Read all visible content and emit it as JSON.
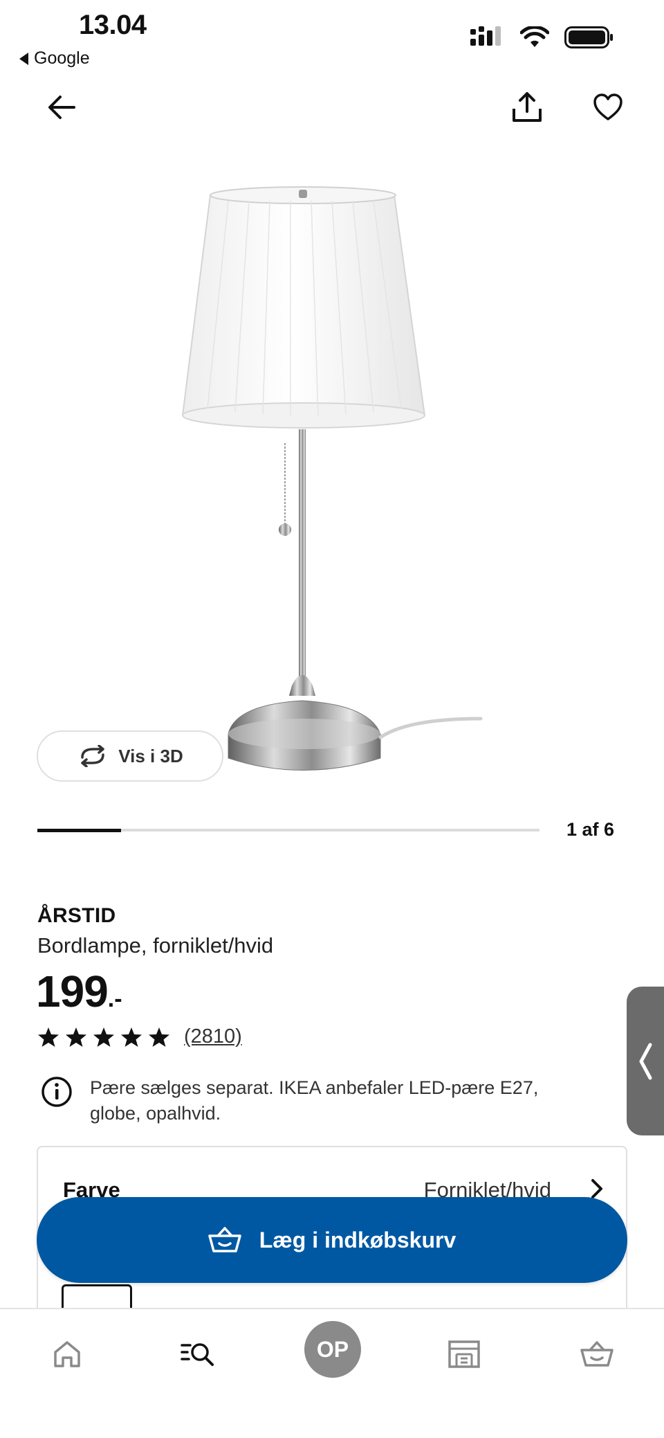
{
  "status_bar": {
    "time": "13.04",
    "back_app": "Google"
  },
  "carousel": {
    "counter": "1 af 6",
    "progress_fraction": 0.1667
  },
  "view_3d": {
    "label": "Vis i 3D"
  },
  "product": {
    "name": "ÅRSTID",
    "description": "Bordlampe, forniklet/hvid",
    "price_integer": "199",
    "price_suffix": ".-",
    "rating_stars": 5,
    "review_count": "(2810)",
    "info_note": "Pære sælges separat. IKEA anbefaler LED-pære E27, globe, opalhvid."
  },
  "options": {
    "color_label": "Farve",
    "color_value": "Forniklet/hvid"
  },
  "cart_button": {
    "label": "Læg i indkøbskurv"
  },
  "bottom_nav": {
    "profile_initials": "OP"
  },
  "colors": {
    "brand_blue": "#0058a3",
    "text": "#111111",
    "avatar_gray": "#8a8a8a"
  }
}
